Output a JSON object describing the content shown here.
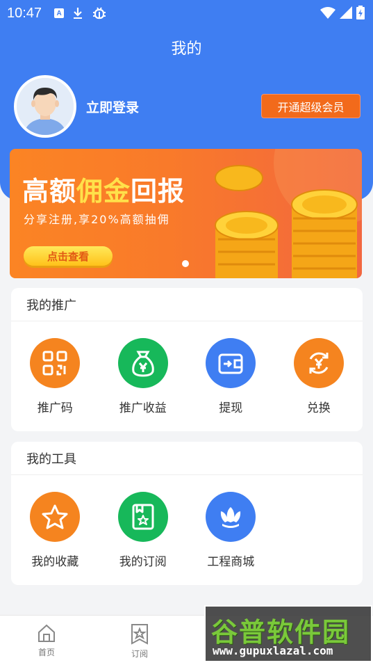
{
  "status_bar": {
    "time": "10:47",
    "left_icons": [
      "a-badge-icon",
      "download-icon",
      "bug-icon"
    ],
    "right_icons": [
      "wifi-icon",
      "signal-icon",
      "battery-charging-icon"
    ]
  },
  "header": {
    "title": "我的",
    "login_text": "立即登录",
    "vip_button": "开通超级会员",
    "accent_color": "#3f7ef2"
  },
  "banner": {
    "title_parts": [
      "高额",
      "佣金",
      "回报"
    ],
    "subtitle": "分享注册,享20%高额抽佣",
    "button": "点击查看"
  },
  "promotion": {
    "title": "我的推广",
    "items": [
      {
        "label": "推广码",
        "icon": "qrcode-icon",
        "color": "#f5841f"
      },
      {
        "label": "推广收益",
        "icon": "money-bag-icon",
        "color": "#17b85a"
      },
      {
        "label": "提现",
        "icon": "wallet-icon",
        "color": "#3f7ef2"
      },
      {
        "label": "兑换",
        "icon": "exchange-icon",
        "color": "#f5841f"
      }
    ]
  },
  "tools": {
    "title": "我的工具",
    "items": [
      {
        "label": "我的收藏",
        "icon": "star-icon",
        "color": "#f5841f"
      },
      {
        "label": "我的订阅",
        "icon": "subscribe-icon",
        "color": "#17b85a"
      },
      {
        "label": "工程商城",
        "icon": "shell-icon",
        "color": "#3f7ef2"
      }
    ]
  },
  "tabbar": {
    "items": [
      {
        "label": "首页",
        "icon": "home-icon"
      },
      {
        "label": "订阅",
        "icon": "subscribe-tab-icon"
      }
    ]
  },
  "watermark": {
    "title": "谷普软件园",
    "url": "www.gupuxlazal.com"
  }
}
